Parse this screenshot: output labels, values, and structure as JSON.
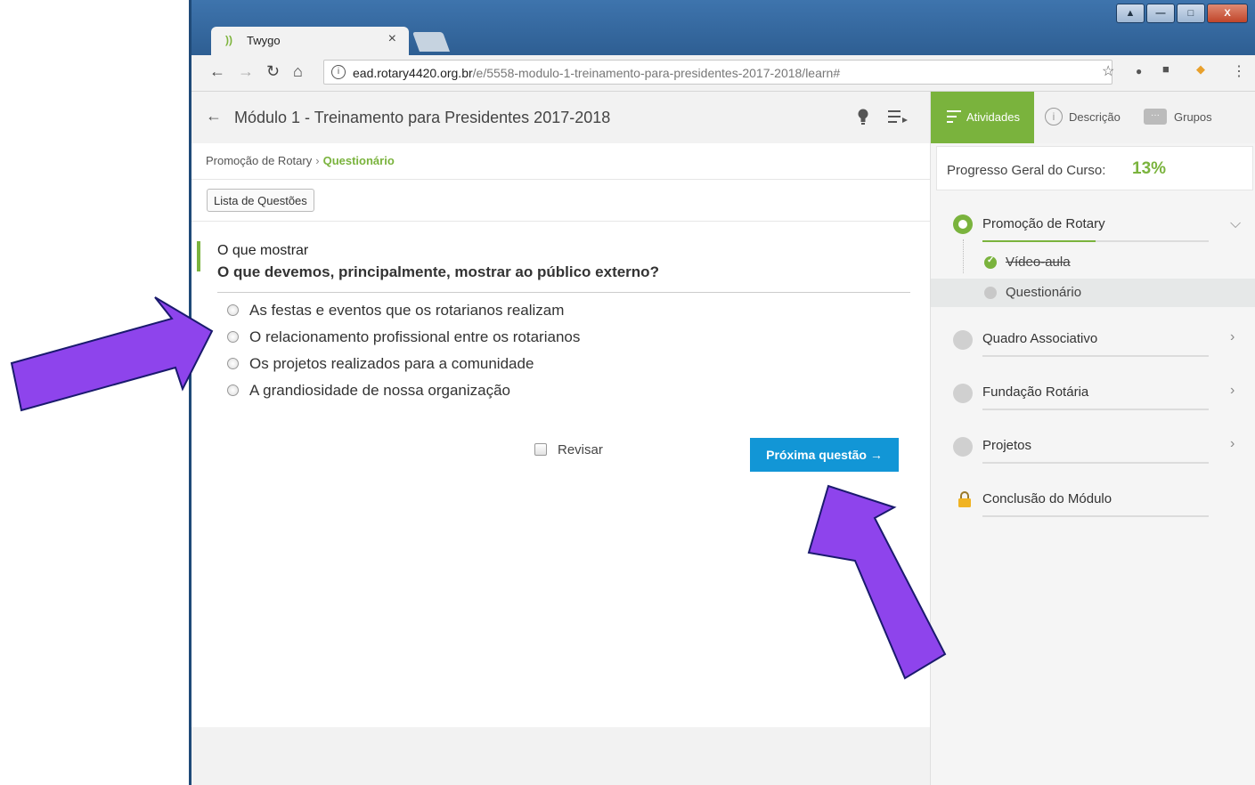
{
  "browser": {
    "tab_title": "Twygo",
    "tab_close": "×",
    "url_host": "ead.rotary4420.org.br",
    "url_path": "/e/5558-modulo-1-treinamento-para-presidentes-2017-2018/learn#"
  },
  "header": {
    "course_title": "Módulo 1 - Treinamento para Presidentes 2017-2018"
  },
  "breadcrumb": {
    "parent": "Promoção de Rotary",
    "separator": "›",
    "current": "Questionário"
  },
  "question_list_button": "Lista de Questões",
  "question": {
    "title": "O que mostrar",
    "text": "O que devemos, principalmente, mostrar ao público externo?",
    "options": [
      "As festas e eventos que os rotarianos realizam",
      "O relacionamento profissional entre os rotarianos",
      "Os projetos realizados para a comunidade",
      "A grandiosidade de nossa organização"
    ]
  },
  "review_label": "Revisar",
  "next_button": "Próxima questão →",
  "sidebar": {
    "tabs": [
      "Atividades",
      "Descrição",
      "Grupos"
    ],
    "progress_label": "Progresso Geral do Curso:",
    "progress_value": "13%",
    "sections": [
      {
        "label": "Promoção de Rotary",
        "progress": 0.5
      },
      {
        "label": "Quadro Associativo",
        "progress": 0
      },
      {
        "label": "Fundação Rotária",
        "progress": 0
      },
      {
        "label": "Projetos",
        "progress": 0
      },
      {
        "label": "Conclusão do Módulo",
        "progress": 0
      }
    ],
    "sub_items": [
      "Vídeo-aula",
      "Questionário"
    ]
  },
  "colors": {
    "accent_green": "#7ab33d",
    "button_blue": "#1296d6",
    "arrow_purple": "#8e44ec"
  }
}
